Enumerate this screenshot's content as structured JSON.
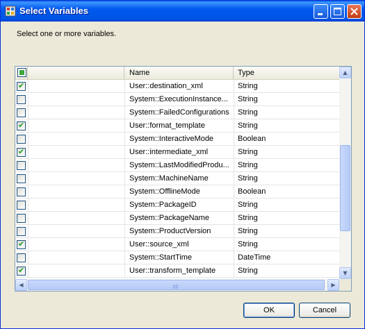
{
  "window": {
    "title": "Select Variables"
  },
  "prompt": "Select one or more variables.",
  "grid": {
    "columns": {
      "name": "Name",
      "type": "Type"
    },
    "rows": [
      {
        "checked": true,
        "name": "User::destination_xml",
        "type": "String"
      },
      {
        "checked": false,
        "name": "System::ExecutionInstance...",
        "type": "String"
      },
      {
        "checked": false,
        "name": "System::FailedConfigurations",
        "type": "String"
      },
      {
        "checked": true,
        "name": "User::format_template",
        "type": "String"
      },
      {
        "checked": false,
        "name": "System::InteractiveMode",
        "type": "Boolean"
      },
      {
        "checked": true,
        "name": "User::intermediate_xml",
        "type": "String"
      },
      {
        "checked": false,
        "name": "System::LastModifiedProdu...",
        "type": "String"
      },
      {
        "checked": false,
        "name": "System::MachineName",
        "type": "String"
      },
      {
        "checked": false,
        "name": "System::OfflineMode",
        "type": "Boolean"
      },
      {
        "checked": false,
        "name": "System::PackageID",
        "type": "String"
      },
      {
        "checked": false,
        "name": "System::PackageName",
        "type": "String"
      },
      {
        "checked": false,
        "name": "System::ProductVersion",
        "type": "String"
      },
      {
        "checked": true,
        "name": "User::source_xml",
        "type": "String"
      },
      {
        "checked": false,
        "name": "System::StartTime",
        "type": "DateTime"
      },
      {
        "checked": true,
        "name": "User::transform_template",
        "type": "String"
      }
    ]
  },
  "buttons": {
    "ok": "OK",
    "cancel": "Cancel"
  },
  "icons": {
    "window_icon": "app-icon",
    "minimize": "minimize-icon",
    "maximize": "maximize-icon",
    "close": "close-icon",
    "checkmark": "✔"
  },
  "colors": {
    "titlebar": "#0058ee",
    "check": "#21a121",
    "close_button": "#c13c12"
  }
}
